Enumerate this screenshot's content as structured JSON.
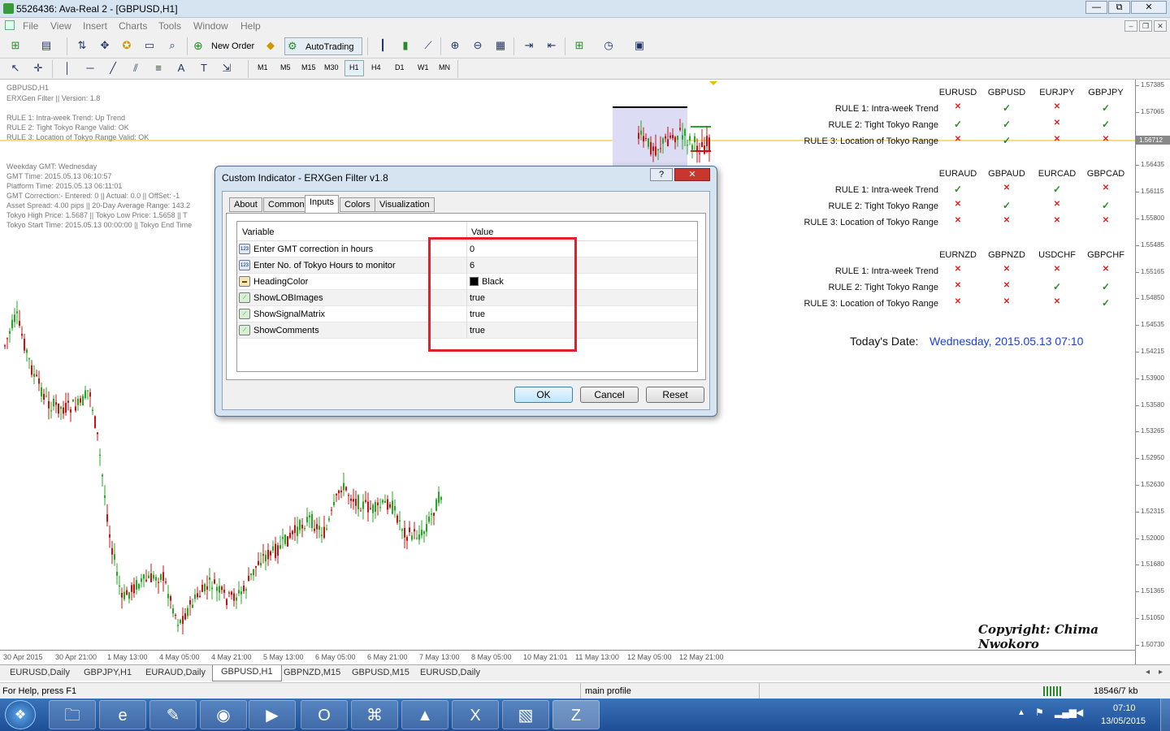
{
  "window": {
    "title": "5526436: Ava-Real 2 - [GBPUSD,H1]",
    "buttons": [
      "—",
      "⧉",
      "✕"
    ]
  },
  "menu": [
    "File",
    "View",
    "Insert",
    "Charts",
    "Tools",
    "Window",
    "Help"
  ],
  "toolbar": {
    "new_order_label": "New Order",
    "autotrading_label": "AutoTrading",
    "timeframes": [
      "M1",
      "M5",
      "M15",
      "M30",
      "H1",
      "H4",
      "D1",
      "W1",
      "MN"
    ],
    "active_timeframe": "H1"
  },
  "chart_info": {
    "symbol_line": "GBPUSD,H1",
    "filter_line": "ERXGen Filter  || Version: 1.8",
    "rule_lines": [
      "RULE 1: Intra-week Trend: Up Trend",
      "RULE 2: Tight Tokyo Range Valid: OK",
      "RULE 3: Location of Tokyo Range Valid: OK"
    ],
    "detail_lines": [
      "Weekday GMT: Wednesday",
      "GMT Time: 2015.05.13 06:10:57",
      "Platform Time: 2015.05.13 06:11:01",
      "GMT Correction:-  Entered: 0  ||  Actual: 0.0   || OffSet: -1",
      "Asset Spread:  4.00 pips  ||  20-Day Average Range:  143.2",
      "Tokyo High Price: 1.5687  ||  Tokyo Low Price: 1.5658  || T",
      "Tokyo Start Time: 2015.05.13 00:00:00  ||  Tokyo End Time"
    ]
  },
  "matrix": {
    "rule_labels": [
      "RULE 1: Intra-week Trend",
      "RULE 2: Tight Tokyo Range",
      "RULE 3: Location of Tokyo Range"
    ],
    "groups": [
      {
        "pairs": [
          "EURUSD",
          "GBPUSD",
          "EURJPY",
          "GBPJPY"
        ],
        "results": [
          [
            "x",
            "ok",
            "x",
            "ok"
          ],
          [
            "ok",
            "ok",
            "x",
            "ok"
          ],
          [
            "x",
            "ok",
            "x",
            "x"
          ]
        ]
      },
      {
        "pairs": [
          "EURAUD",
          "GBPAUD",
          "EURCAD",
          "GBPCAD"
        ],
        "results": [
          [
            "ok",
            "x",
            "ok",
            "x"
          ],
          [
            "x",
            "ok",
            "x",
            "ok"
          ],
          [
            "x",
            "x",
            "x",
            "x"
          ]
        ]
      },
      {
        "pairs": [
          "EURNZD",
          "GBPNZD",
          "USDCHF",
          "GBPCHF"
        ],
        "results": [
          [
            "x",
            "x",
            "x",
            "x"
          ],
          [
            "x",
            "x",
            "ok",
            "ok"
          ],
          [
            "x",
            "x",
            "x",
            "ok"
          ]
        ]
      }
    ],
    "date_label": "Today's Date:",
    "date_value": "Wednesday, 2015.05.13 07:10",
    "copyright": "Copyright: Chima Nwokoro"
  },
  "price_scale": [
    "1.57385",
    "1.57065",
    "1.56745",
    "1.56435",
    "1.56115",
    "1.55800",
    "1.55485",
    "1.55165",
    "1.54850",
    "1.54535",
    "1.54215",
    "1.53900",
    "1.53580",
    "1.53265",
    "1.52950",
    "1.52630",
    "1.52315",
    "1.52000",
    "1.51680",
    "1.51365",
    "1.51050",
    "1.50730"
  ],
  "current_price": "1.56712",
  "time_axis": [
    "30 Apr 2015",
    "30 Apr 21:00",
    "1 May 13:00",
    "4 May 05:00",
    "4 May 21:00",
    "5 May 13:00",
    "6 May 05:00",
    "6 May 21:00",
    "7 May 13:00",
    "8 May 05:00",
    "10 May 21:01",
    "11 May 13:00",
    "12 May 05:00",
    "12 May 21:00"
  ],
  "chart_tabs": [
    "EURUSD,Daily",
    "GBPJPY,H1",
    "EURAUD,Daily",
    "GBPUSD,H1",
    "GBPNZD,M15",
    "GBPUSD,M15",
    "EURUSD,Daily"
  ],
  "active_chart_tab": "GBPUSD,H1",
  "status": {
    "help": "For Help, press F1",
    "profile": "main profile",
    "traffic": "18546/7 kb"
  },
  "dialog": {
    "title": "Custom Indicator - ERXGen Filter v1.8",
    "tabs": [
      "About",
      "Common",
      "Inputs",
      "Colors",
      "Visualization"
    ],
    "active_tab": "Inputs",
    "col_variable": "Variable",
    "col_value": "Value",
    "rows": [
      {
        "name": "Enter GMT correction in hours",
        "value": "0",
        "icon": "int-icon"
      },
      {
        "name": "Enter No. of Tokyo Hours to monitor",
        "value": "6",
        "icon": "int-icon"
      },
      {
        "name": "HeadingColor",
        "value": "Black",
        "icon": "color-icon"
      },
      {
        "name": "ShowLOBImages",
        "value": "true",
        "icon": "bool-icon"
      },
      {
        "name": "ShowSignalMatrix",
        "value": "true",
        "icon": "bool-icon"
      },
      {
        "name": "ShowComments",
        "value": "true",
        "icon": "bool-icon"
      }
    ],
    "ok": "OK",
    "cancel": "Cancel",
    "reset": "Reset",
    "highlight_color": "#e0202a"
  },
  "taskbar": {
    "clock_time": "07:10",
    "clock_date": "13/05/2015"
  },
  "colors": {
    "bull": "#22aa22",
    "bear": "#cc1111",
    "price_line": "#e8c000",
    "date_blue": "#1a3fd6"
  }
}
